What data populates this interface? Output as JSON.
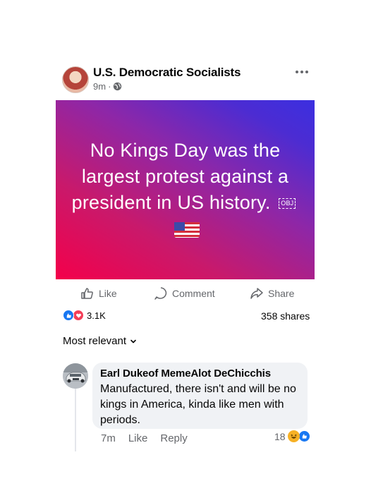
{
  "post": {
    "page_name": "U.S. Democratic Socialists",
    "time": "9m",
    "separator": "·",
    "privacy_icon": "globe-icon",
    "more_icon": "more-horizontal-icon",
    "image_text": "No Kings Day was the largest protest against a president in US history.",
    "image_obj_label": "OBJ",
    "image_flag_icon": "us-flag-icon",
    "gradient_colors": [
      "#f4004a",
      "#8d27a8",
      "#3b2fe0"
    ]
  },
  "actions": {
    "like_label": "Like",
    "comment_label": "Comment",
    "share_label": "Share"
  },
  "stats": {
    "reactions_count": "3.1K",
    "shares": "358 shares"
  },
  "comments_sort": {
    "label": "Most relevant"
  },
  "comment": {
    "author": "Earl Dukeof MemeAlot DeChicchis",
    "text": "Manufactured, there isn't and will be no kings in America, kinda like men with periods.",
    "time": "7m",
    "like_label": "Like",
    "reply_label": "Reply",
    "reaction_count": "18"
  },
  "colors": {
    "accent": "#1877f2",
    "love": "#f33e58",
    "haha": "#f7b125",
    "muted_text": "#65676b",
    "bubble_bg": "#f0f2f5"
  }
}
